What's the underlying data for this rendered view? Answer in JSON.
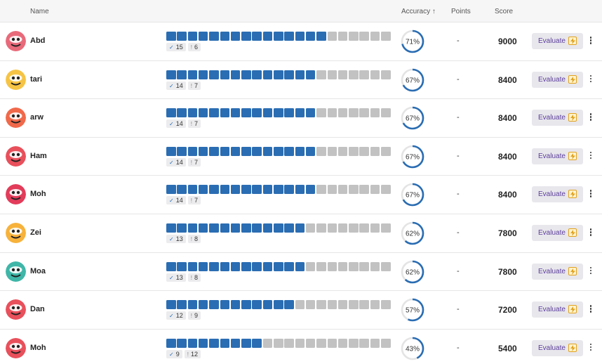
{
  "header": {
    "name": "Name",
    "accuracy": "Accuracy ↑",
    "points": "Points",
    "score": "Score"
  },
  "total_questions": 21,
  "colors": {
    "correct": "#2a6db3",
    "incorrect": "#c2c2c2",
    "accent": "#5b3d9c"
  },
  "rows": [
    {
      "name": "Abd",
      "correct": 15,
      "incorrect": 6,
      "correct_label": "15",
      "incorrect_label": "6",
      "accuracy": 71,
      "accuracy_label": "71%",
      "points": "-",
      "score": "9000",
      "evaluate_label": "Evaluate",
      "avatar_color": "#e86a7a",
      "avatar_icon": "monster-avatar-icon"
    },
    {
      "name": "tari",
      "correct": 14,
      "incorrect": 7,
      "correct_label": "14",
      "incorrect_label": "7",
      "accuracy": 67,
      "accuracy_label": "67%",
      "points": "-",
      "score": "8400",
      "evaluate_label": "Evaluate",
      "avatar_color": "#f6c445",
      "avatar_icon": "monster-avatar-icon"
    },
    {
      "name": "arw",
      "correct": 14,
      "incorrect": 7,
      "correct_label": "14",
      "incorrect_label": "7",
      "accuracy": 67,
      "accuracy_label": "67%",
      "points": "-",
      "score": "8400",
      "evaluate_label": "Evaluate",
      "avatar_color": "#f0694a",
      "avatar_icon": "monster-avatar-icon"
    },
    {
      "name": "Ham",
      "correct": 14,
      "incorrect": 7,
      "correct_label": "14",
      "incorrect_label": "7",
      "accuracy": 67,
      "accuracy_label": "67%",
      "points": "-",
      "score": "8400",
      "evaluate_label": "Evaluate",
      "avatar_color": "#e8505b",
      "avatar_icon": "monster-avatar-icon"
    },
    {
      "name": "Moh",
      "correct": 14,
      "incorrect": 7,
      "correct_label": "14",
      "incorrect_label": "7",
      "accuracy": 67,
      "accuracy_label": "67%",
      "points": "-",
      "score": "8400",
      "evaluate_label": "Evaluate",
      "avatar_color": "#e23c5a",
      "avatar_icon": "monster-avatar-icon"
    },
    {
      "name": "Zei",
      "correct": 13,
      "incorrect": 8,
      "correct_label": "13",
      "incorrect_label": "8",
      "accuracy": 62,
      "accuracy_label": "62%",
      "points": "-",
      "score": "7800",
      "evaluate_label": "Evaluate",
      "avatar_color": "#f7b23b",
      "avatar_icon": "monster-avatar-icon"
    },
    {
      "name": "Moa",
      "correct": 13,
      "incorrect": 8,
      "correct_label": "13",
      "incorrect_label": "8",
      "accuracy": 62,
      "accuracy_label": "62%",
      "points": "-",
      "score": "7800",
      "evaluate_label": "Evaluate",
      "avatar_color": "#3fb6a8",
      "avatar_icon": "monster-avatar-icon"
    },
    {
      "name": "Dan",
      "correct": 12,
      "incorrect": 9,
      "correct_label": "12",
      "incorrect_label": "9",
      "accuracy": 57,
      "accuracy_label": "57%",
      "points": "-",
      "score": "7200",
      "evaluate_label": "Evaluate",
      "avatar_color": "#e8505b",
      "avatar_icon": "monster-avatar-icon"
    },
    {
      "name": "Moh",
      "correct": 9,
      "incorrect": 12,
      "correct_label": "9",
      "incorrect_label": "12",
      "accuracy": 43,
      "accuracy_label": "43%",
      "points": "-",
      "score": "5400",
      "evaluate_label": "Evaluate",
      "avatar_color": "#e8505b",
      "avatar_icon": "monster-avatar-icon"
    }
  ]
}
